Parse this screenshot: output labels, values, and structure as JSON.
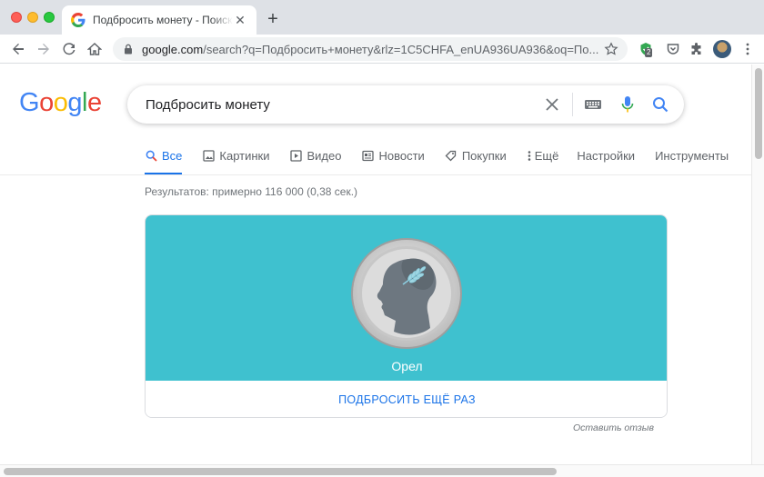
{
  "browser": {
    "tab_title": "Подбросить монету - Поиск в Google",
    "new_tab_symbol": "+",
    "url_host": "google.com",
    "url_path": "/search?q=Подбросить+монету&rlz=1C5CHFA_enUA936UA936&oq=По...",
    "extension_badge": "2"
  },
  "search": {
    "query": "Подбросить монету"
  },
  "nav": {
    "tabs": [
      {
        "label": "Все",
        "icon": "search-icon",
        "active": true
      },
      {
        "label": "Картинки",
        "icon": "image-icon"
      },
      {
        "label": "Видео",
        "icon": "play-icon"
      },
      {
        "label": "Новости",
        "icon": "news-icon"
      },
      {
        "label": "Покупки",
        "icon": "tag-icon"
      },
      {
        "label": "Ещё",
        "icon": "more-vert-icon"
      },
      {
        "label": "Настройки"
      },
      {
        "label": "Инструменты"
      }
    ]
  },
  "results_count": "Результатов: примерно 116 000 (0,38 сек.)",
  "coin": {
    "result_label": "Орел",
    "flip_again_label": "ПОДБРОСИТЬ ЕЩЁ РАЗ",
    "feedback_label": "Оставить отзыв"
  },
  "colors": {
    "coin_stage": "#3fc1cf",
    "accent": "#1a73e8",
    "google_blue": "#4285f4",
    "google_red": "#ea4335",
    "google_yellow": "#fbbc05",
    "google_green": "#34a853"
  }
}
